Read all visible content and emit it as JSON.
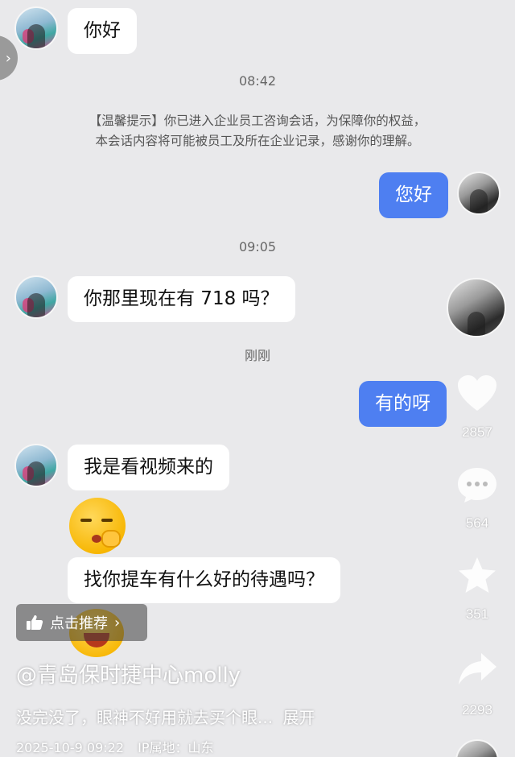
{
  "chat": {
    "msg1": "你好",
    "time1": "08:42",
    "notice_line1": "【温馨提示】你已进入企业员工咨询会话，为保障你的权益，",
    "notice_line2": "本会话内容将可能被员工及所在企业记录，感谢你的理解。",
    "msg2": "您好",
    "time2": "09:05",
    "msg3": "你那里现在有 718 吗？",
    "time3": "刚刚",
    "msg4": "有的呀",
    "msg5": "我是看视频来的",
    "msg6": "找你提车有什么好的待遇吗？"
  },
  "sidebar": {
    "like_count": "2857",
    "comment_count": "564",
    "favorite_count": "351",
    "share_count": "2293"
  },
  "overlay": {
    "recommend_label": "点击推荐",
    "author": "@青岛保时捷中心molly",
    "description": "没完没了，眼神不好用就去买个眼...",
    "expand": "展开",
    "date": "2025-10-9 09:22",
    "ip_location": "IP属地：山东"
  },
  "colors": {
    "background": "#e9e9eb",
    "outgoing_bubble": "#4e7ff1",
    "incoming_bubble": "#ffffff"
  },
  "icons": [
    "thumbs-up-icon",
    "heart-icon",
    "comment-icon",
    "star-icon",
    "share-icon",
    "chevron-right-icon"
  ]
}
